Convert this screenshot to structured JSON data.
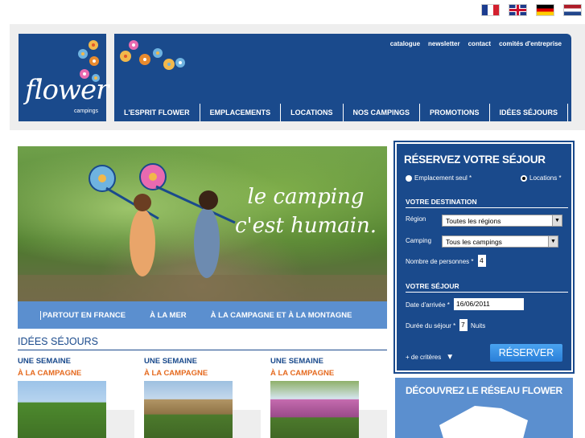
{
  "flags": [
    {
      "name": "french-flag-icon",
      "label": "Français"
    },
    {
      "name": "english-flag-icon",
      "label": "English"
    },
    {
      "name": "german-flag-icon",
      "label": "Deutsch"
    },
    {
      "name": "dutch-flag-icon",
      "label": "Nederlands"
    }
  ],
  "logo": {
    "main": "flower",
    "sub": "campings"
  },
  "toplinks": [
    "catalogue",
    "newsletter",
    "contact",
    "comités d'entreprise"
  ],
  "mainnav": [
    "L'ESPRIT FLOWER",
    "EMPLACEMENTS",
    "LOCATIONS",
    "NOS CAMPINGS",
    "PROMOTIONS",
    "IDÉES SÉJOURS"
  ],
  "hero": {
    "slogan": "le camping c'est humain.",
    "tabs": [
      "PARTOUT EN FRANCE",
      "À LA MER",
      "À LA CAMPAGNE ET À LA MONTAGNE"
    ]
  },
  "ideas": {
    "title": "IDÉES SÉJOURS",
    "items": [
      {
        "line1": "UNE SEMAINE",
        "line2": "À LA CAMPAGNE"
      },
      {
        "line1": "UNE SEMAINE",
        "line2": "À LA CAMPAGNE"
      },
      {
        "line1": "UNE SEMAINE",
        "line2": "À LA CAMPAGNE"
      }
    ]
  },
  "reservation": {
    "title": "RÉSERVEZ VOTRE SÉJOUR",
    "radio_emplacement": "Emplacement seul *",
    "radio_locations": "Locations *",
    "destination_title": "VOTRE DESTINATION",
    "region_label": "Région",
    "region_value": "Toutes les régions",
    "camping_label": "Camping",
    "camping_value": "Tous les campings",
    "persons_label": "Nombre de personnes *",
    "persons_value": "4",
    "stay_title": "VOTRE SÉJOUR",
    "arrival_label": "Date d'arrivée *",
    "arrival_value": "16/06/2011",
    "duration_label": "Durée du séjour *",
    "duration_value": "7",
    "duration_unit": "Nuits",
    "criteria": "+ de critères",
    "submit": "RÉSERVER"
  },
  "discover": {
    "title": "DÉCOUVREZ LE RÉSEAU FLOWER"
  }
}
